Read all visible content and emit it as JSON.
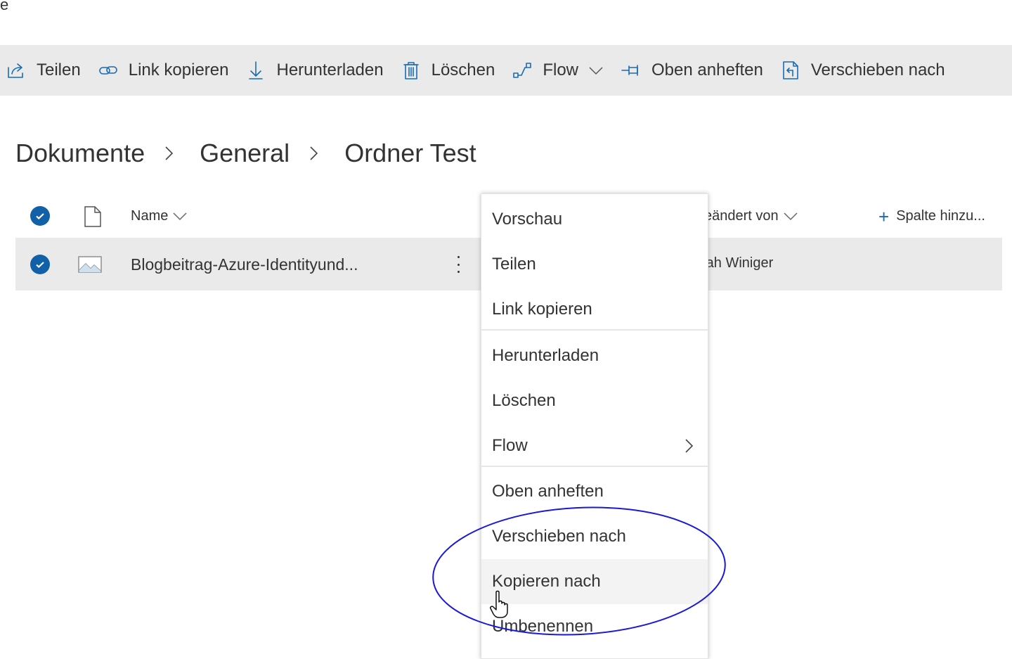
{
  "page_stub": "e",
  "command_bar": [
    {
      "label": "Teilen",
      "icon": "share-icon"
    },
    {
      "label": "Link kopieren",
      "icon": "link-icon"
    },
    {
      "label": "Herunterladen",
      "icon": "download-icon"
    },
    {
      "label": "Löschen",
      "icon": "trash-icon"
    },
    {
      "label": "Flow",
      "icon": "flow-icon"
    },
    {
      "label": "Oben anheften",
      "icon": "pin-icon"
    },
    {
      "label": "Verschieben nach",
      "icon": "move-icon"
    }
  ],
  "breadcrumb": [
    "Dokumente",
    "General",
    "Ordner Test"
  ],
  "list": {
    "columns": {
      "name": "Name",
      "modified_by": "eändert von",
      "add_column": "Spalte hinzu..."
    },
    "rows": [
      {
        "name": "Blogbeitrag-Azure-Identityund...",
        "modified_by": "rah Winiger",
        "selected": true
      }
    ]
  },
  "context_menu": {
    "items": [
      {
        "label": "Vorschau"
      },
      {
        "label": "Teilen"
      },
      {
        "label": "Link kopieren"
      },
      {
        "label": "Herunterladen"
      },
      {
        "label": "Löschen"
      },
      {
        "label": "Flow",
        "has_submenu": true
      },
      {
        "label": "Oben anheften"
      },
      {
        "label": "Verschieben nach"
      },
      {
        "label": "Kopieren nach",
        "highlighted": true
      },
      {
        "label": "Umbenennen"
      }
    ]
  },
  "colors": {
    "accent": "#1160a8",
    "icon_blue": "#1a6bb5",
    "command_bar_bg": "#eaeaea",
    "annotation_circle": "#1a1ad6"
  }
}
